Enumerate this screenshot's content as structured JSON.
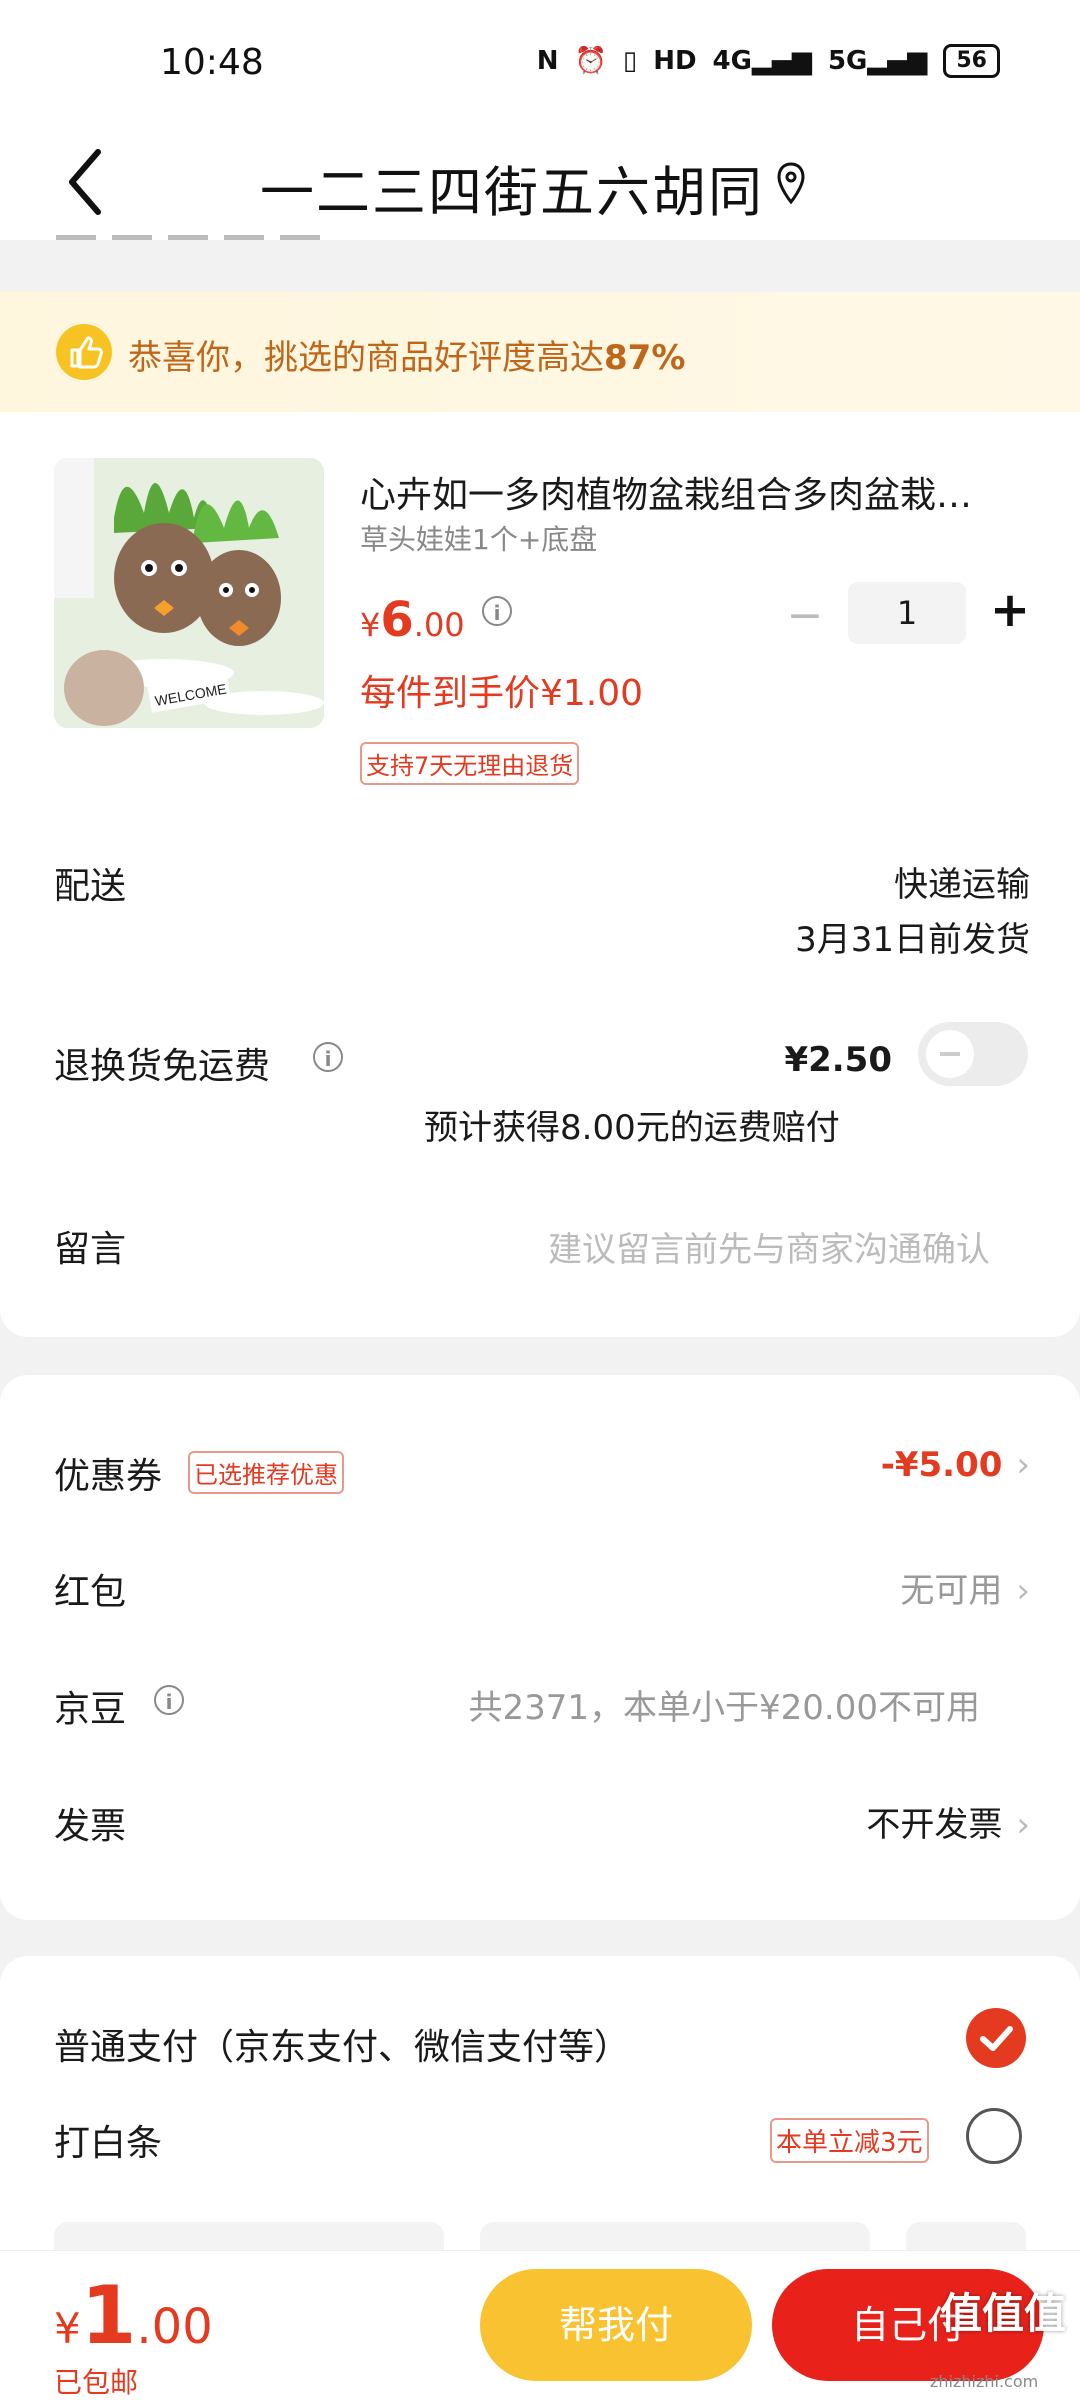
{
  "status_bar": {
    "time": "10:48",
    "icons": [
      "nfc-icon",
      "alarm-icon",
      "vibrate-icon",
      "hd-icon",
      "4g-signal-icon",
      "5g-signal-icon"
    ],
    "battery": "56"
  },
  "header": {
    "title": "一二三四街五六胡同"
  },
  "banner": {
    "text_prefix": "恭喜你，挑选的商品好评度高达",
    "rate": "87%"
  },
  "product": {
    "title": "心卉如一多肉植物盆栽组合多肉盆栽…",
    "spec": "草头娃娃1个+底盘",
    "price_symbol": "¥",
    "price_int": "6",
    "price_dec": ".00",
    "quantity": "1",
    "unit_price": "每件到手价¥1.00",
    "return_tag": "支持7天无理由退货",
    "image_caption": "WELCOME"
  },
  "delivery": {
    "label": "配送",
    "method": "快递运输",
    "date": "3月31日前发货"
  },
  "return_shipping": {
    "label": "退换货免运费",
    "price": "¥2.50",
    "note": "预计获得8.00元的运费赔付"
  },
  "note": {
    "label": "留言",
    "placeholder": "建议留言前先与商家沟通确认"
  },
  "coupon": {
    "label": "优惠券",
    "tag": "已选推荐优惠",
    "value": "-¥5.00"
  },
  "red_packet": {
    "label": "红包",
    "value": "无可用"
  },
  "jd_beans": {
    "label": "京豆",
    "value": "共2371，本单小于¥20.00不可用"
  },
  "invoice": {
    "label": "发票",
    "value": "不开发票"
  },
  "payment": {
    "normal": "普通支付（京东支付、微信支付等）",
    "baitiao": "打白条",
    "baitiao_tag": "本单立减3元"
  },
  "bottom": {
    "total_symbol": "¥",
    "total_int": "1",
    "total_dec": ".00",
    "shipping": "已包邮",
    "help_pay": "帮我付",
    "self_pay": "自己付"
  },
  "watermark": {
    "main": "值值值",
    "sub": "zhizhizhi.com"
  },
  "colors": {
    "accent_red": "#e33a20",
    "button_yellow": "#f8c231",
    "button_red": "#e8221b",
    "banner_text": "#c0661a"
  }
}
